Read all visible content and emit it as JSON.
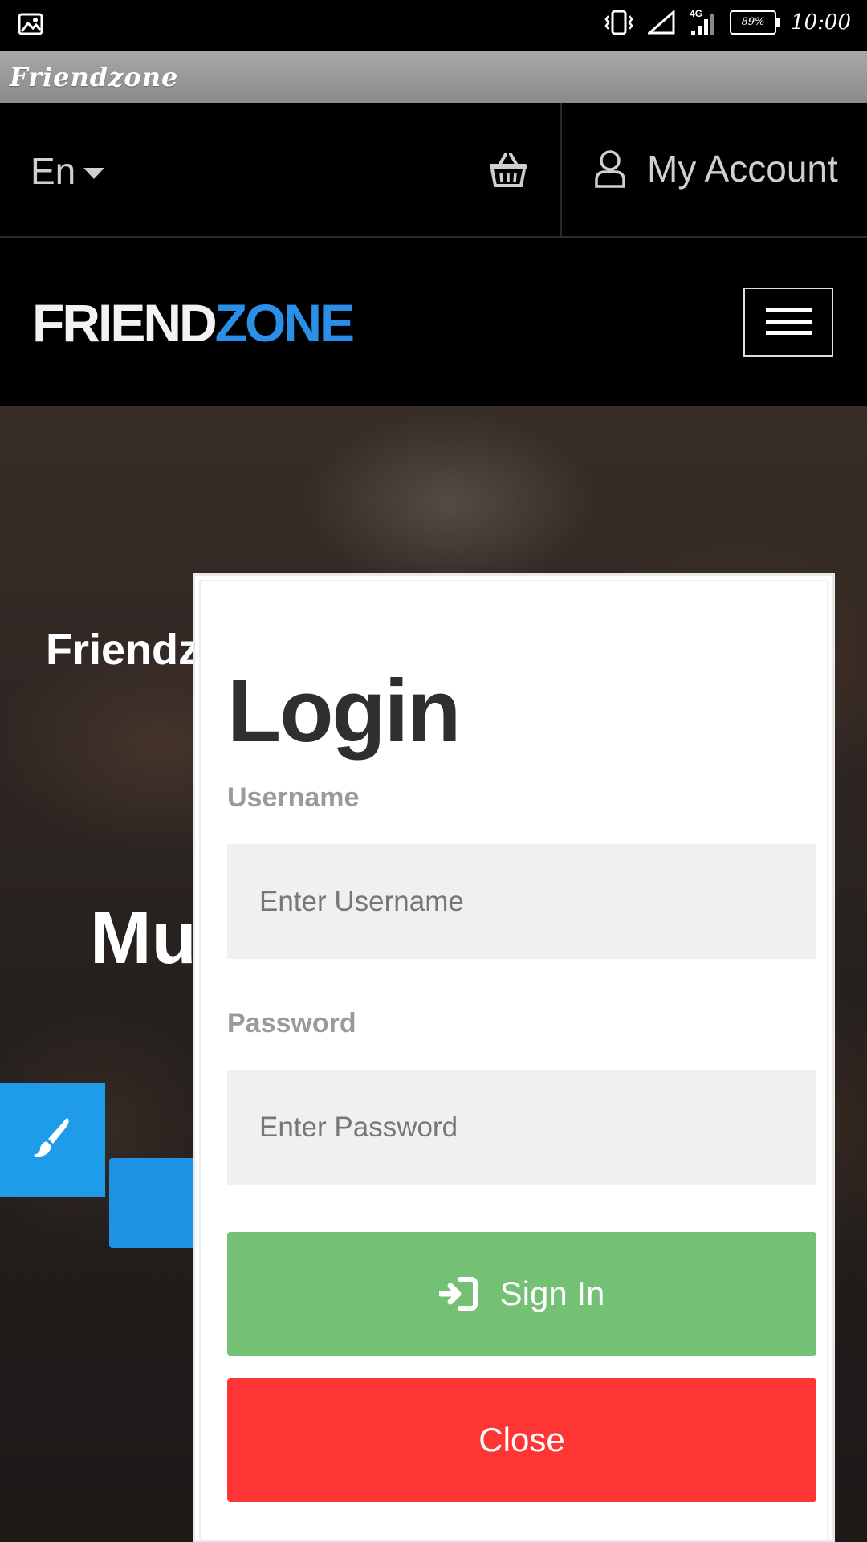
{
  "status_bar": {
    "time": "10:00",
    "battery": "89%",
    "network": "4G",
    "icons": [
      "image-icon",
      "vibrate-icon",
      "signal-icon",
      "battery-icon"
    ]
  },
  "app": {
    "title": "Friendzone"
  },
  "top_nav": {
    "language": "En",
    "cart_icon": "basket-icon",
    "account_label": "My Account"
  },
  "header": {
    "logo_part1": "FRIEND",
    "logo_part2": "ZONE",
    "logo_colors": {
      "friend": "#f2f2f2",
      "zone": "#2a8fe6"
    }
  },
  "hero": {
    "title_partial": "Friendz",
    "heading_partial": "Mu"
  },
  "login_modal": {
    "heading": "Login",
    "username_label": "Username",
    "username_placeholder": "Enter Username",
    "password_label": "Password",
    "password_placeholder": "Enter Password",
    "signin_label": "Sign In",
    "close_label": "Close",
    "colors": {
      "signin": "#74c074",
      "close": "#ff3535",
      "accent": "#1e9be9"
    }
  }
}
